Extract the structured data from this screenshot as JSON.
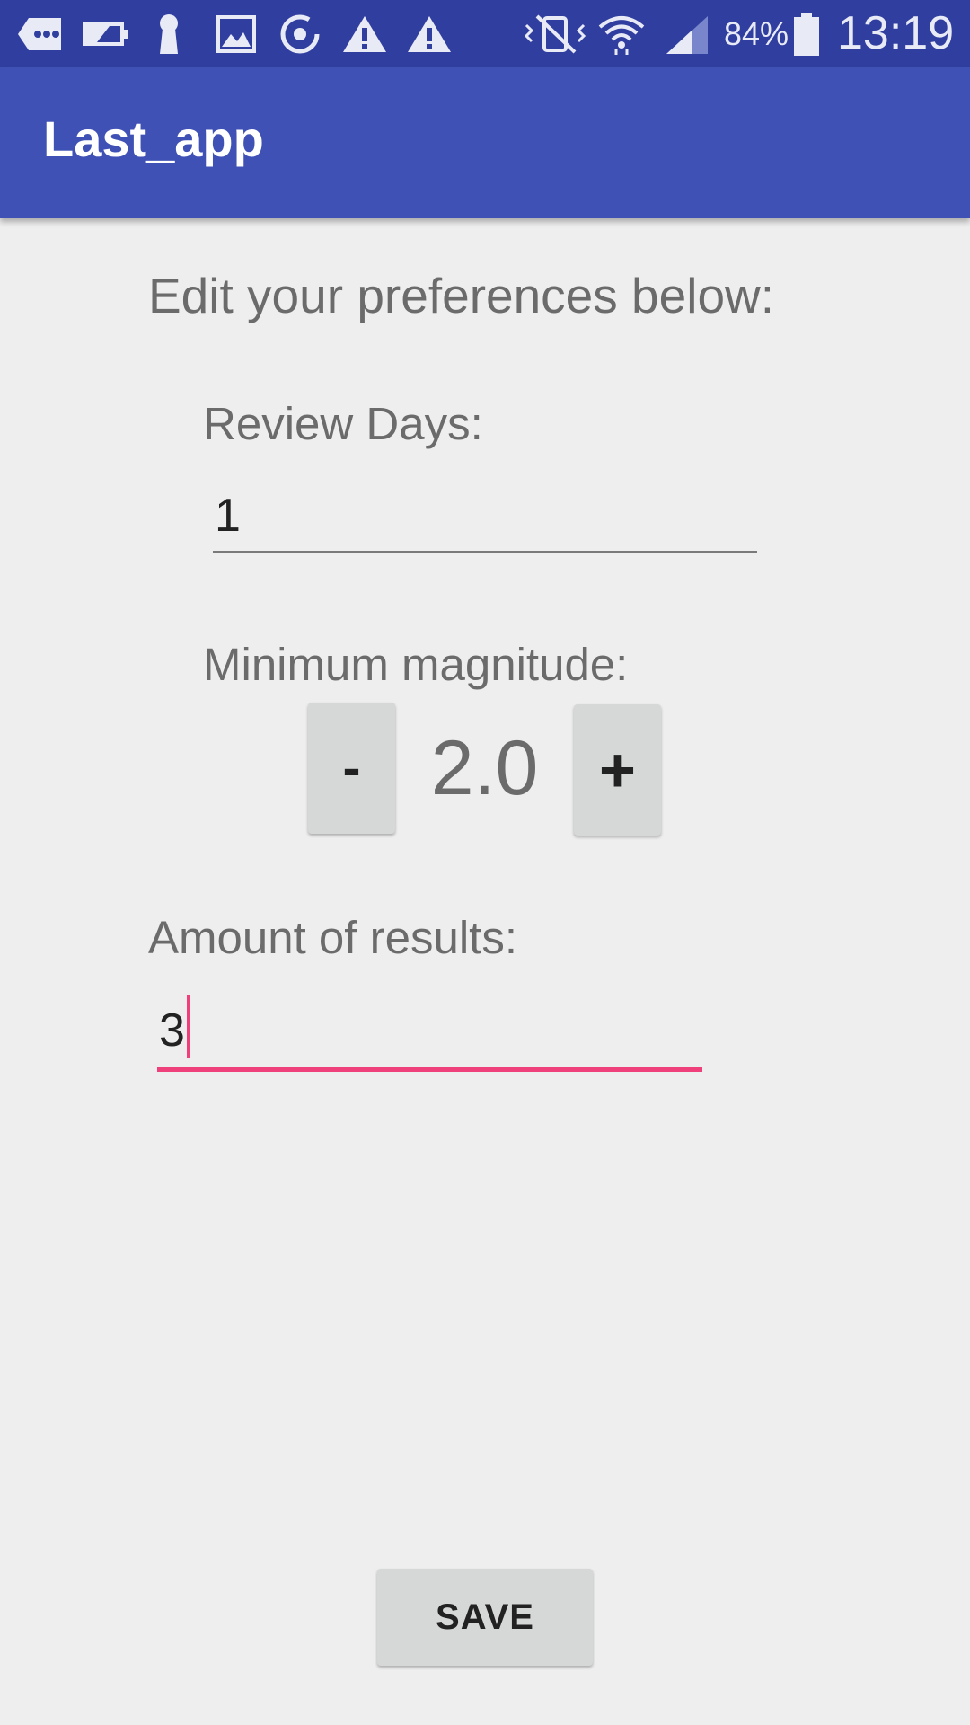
{
  "status_bar": {
    "icons": [
      "chat-bubble-icon",
      "battery-low-icon",
      "keyhole-icon",
      "image-icon",
      "sync-icon",
      "warning-icon",
      "warning-icon",
      "vibrate-icon",
      "wifi-icon",
      "signal-icon",
      "battery-icon"
    ],
    "battery_percent": "84%",
    "time": "13:19"
  },
  "app_bar": {
    "title": "Last_app"
  },
  "preferences": {
    "heading": "Edit your preferences below:",
    "review_days": {
      "label": "Review Days:",
      "value": "1"
    },
    "min_magnitude": {
      "label": "Minimum magnitude:",
      "decrement_label": "-",
      "value": "2.0",
      "increment_label": "+"
    },
    "amount_results": {
      "label": "Amount of results:",
      "value": "3"
    },
    "save_label": "SAVE"
  },
  "colors": {
    "status_bar": "#303f9f",
    "app_bar": "#3f51b5",
    "accent": "#f0407b",
    "background": "#eeeeee"
  }
}
